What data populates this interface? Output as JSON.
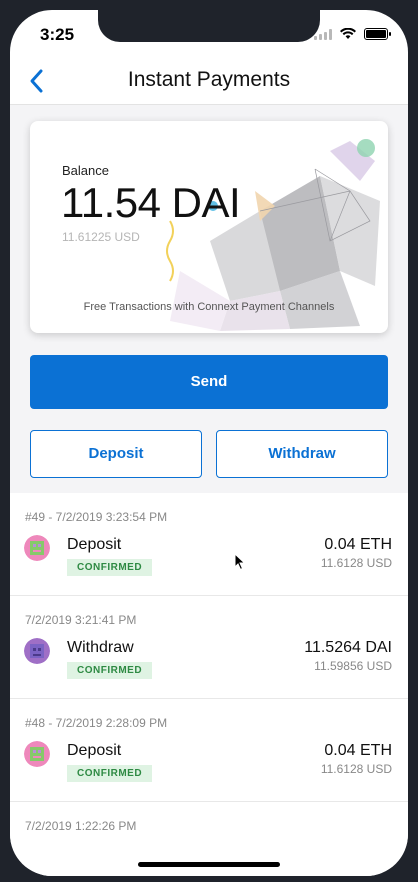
{
  "status_bar": {
    "time": "3:25"
  },
  "nav": {
    "title": "Instant Payments"
  },
  "card": {
    "balance_label": "Balance",
    "balance_amount": "11.54 DAI",
    "balance_usd": "11.61225 USD",
    "footer": "Free Transactions with Connext Payment Channels"
  },
  "actions": {
    "send": "Send",
    "deposit": "Deposit",
    "withdraw": "Withdraw"
  },
  "transactions": [
    {
      "meta": "#49  - 7/2/2019 3:23:54 PM",
      "type": "Deposit",
      "status": "CONFIRMED",
      "amount": "0.04 ETH",
      "usd": "11.6128 USD"
    },
    {
      "meta": "7/2/2019 3:21:41 PM",
      "type": "Withdraw",
      "status": "CONFIRMED",
      "amount": "11.5264 DAI",
      "usd": "11.59856 USD"
    },
    {
      "meta": "#48  - 7/2/2019 2:28:09 PM",
      "type": "Deposit",
      "status": "CONFIRMED",
      "amount": "0.04 ETH",
      "usd": "11.6128 USD"
    },
    {
      "meta": "7/2/2019 1:22:26 PM"
    }
  ],
  "colors": {
    "accent": "#0b71d4",
    "confirmed_bg": "#dff3e3",
    "confirmed_text": "#2e8a43"
  },
  "icons": [
    "back-chevron-icon",
    "signal-icon",
    "wifi-icon",
    "battery-icon",
    "avatar-icon",
    "cursor-icon"
  ]
}
